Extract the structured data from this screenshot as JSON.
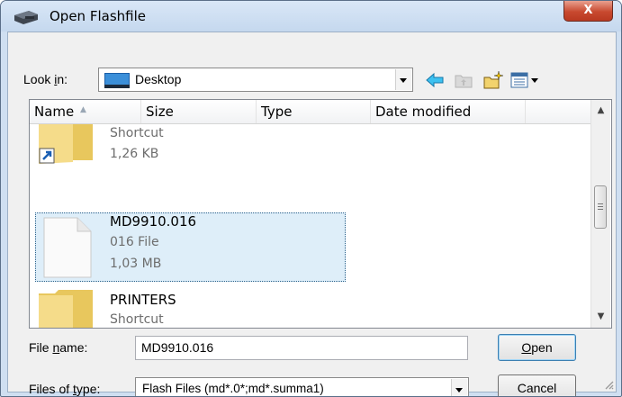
{
  "window": {
    "title": "Open Flashfile",
    "close_label": "X"
  },
  "lookin": {
    "label_pre": "Look ",
    "label_accel": "i",
    "label_post": "n:",
    "value": "Desktop"
  },
  "toolbar": {
    "icons": [
      "back-arrow-icon",
      "up-folder-icon",
      "new-folder-icon",
      "view-menu-icon"
    ]
  },
  "list": {
    "columns": [
      "Name",
      "Size",
      "Type",
      "Date modified"
    ],
    "items": [
      {
        "name": "",
        "lines": [
          "Shortcut",
          "1,26 KB"
        ],
        "icon": "folder-shortcut-icon"
      },
      {
        "name": "MD9910.016",
        "lines": [
          "016 File",
          "1,03 MB"
        ],
        "icon": "file-icon",
        "selected": true
      },
      {
        "name": "PRINTERS",
        "lines": [
          "Shortcut"
        ],
        "icon": "folder-icon"
      }
    ]
  },
  "filename": {
    "label_pre": "File ",
    "label_accel": "n",
    "label_post": "ame:",
    "value": "MD9910.016"
  },
  "filetype": {
    "label_pre": "Files of ",
    "label_accel": "t",
    "label_post": "ype:",
    "value": "Flash Files (md*.0*;md*.summa1)"
  },
  "buttons": {
    "open_accel": "O",
    "open_rest": "pen",
    "cancel": "Cancel"
  },
  "colors": {
    "selection_bg": "#deeef9",
    "title_bar": "#c5d8ee",
    "close_button": "#c8492f"
  }
}
